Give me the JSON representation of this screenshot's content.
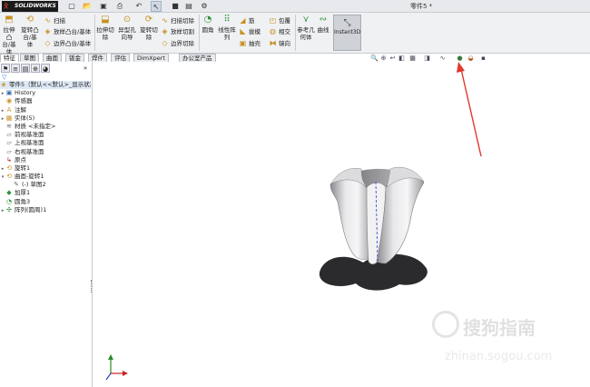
{
  "app": {
    "logo_text": "SOLIDWORKS",
    "doc_title": "零件5 *"
  },
  "ribbon": {
    "extrude_boss": "拉伸凸\n台/基\n体",
    "revolve_boss": "旋转凸\n台/基\n体",
    "sweep": "扫描",
    "loft": "放样凸台/基体",
    "boundary": "边界凸台/基体",
    "extrude_cut": "拉伸切\n除",
    "hole_wizard": "异型孔\n向导",
    "revolve_cut": "旋转切\n除",
    "swept_cut": "扫描切除",
    "lofted_cut": "放样切割",
    "boundary_cut": "边界切除",
    "fillet": "圆角",
    "linear_pattern": "线性阵\n列",
    "rib": "筋",
    "draft": "拔模",
    "shell": "抽壳",
    "wrap": "包覆",
    "intersect": "相交",
    "mirror": "镜向",
    "ref_geometry": "参考几\n何体",
    "curves": "曲线",
    "instant3d": "Instant3D"
  },
  "tabs": [
    "特征",
    "草图",
    "曲面",
    "钣金",
    "焊件",
    "评估",
    "DimXpert",
    "办公室产品"
  ],
  "tree": {
    "root": "零件5（默认<<默认>_显示状态",
    "items": [
      "History",
      "传感器",
      "注解",
      "实体(5)",
      "材质 <未指定>",
      "前视基准面",
      "上视基准面",
      "右视基准面",
      "原点",
      "旋转1",
      "曲面-旋转1",
      "(-) 草图2",
      "加厚1",
      "圆角3",
      "阵列(圆周)1"
    ]
  },
  "watermark": {
    "main": "搜狗指南",
    "sub": "zhinan.sogou.com"
  },
  "colors": {
    "arrow": "#e03a2f",
    "axis_x": "#cc2222",
    "axis_y": "#2a8a2a",
    "axis_z": "#2244cc"
  },
  "icons": {
    "titlebar": [
      "new-icon",
      "open-icon",
      "save-icon",
      "print-icon",
      "undo-icon",
      "select-icon",
      "rebuild-icon",
      "file-props-icon",
      "options-icon"
    ],
    "view": [
      "zoom-fit-icon",
      "zoom-area-icon",
      "previous-view-icon",
      "section-view-icon",
      "view-orientation-icon",
      "display-style-icon",
      "hide-show-icon",
      "edit-appearance-icon",
      "apply-scene-icon",
      "view-settings-icon"
    ]
  }
}
